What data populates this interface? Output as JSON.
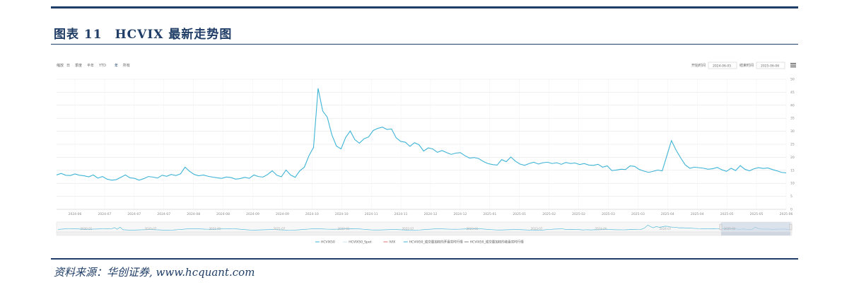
{
  "header": {
    "figure_title": "图表 11　HCVIX 最新走势图"
  },
  "source_note": "资料来源：华创证券, www.hcquant.com",
  "toolbar": {
    "zoom_label": "缩放",
    "zoom_options": [
      "日",
      "季度",
      "半年",
      "YTD",
      "年",
      "所有"
    ],
    "start_label": "开始时间",
    "start_value": "2024-06-05",
    "end_label": "结束时间",
    "end_value": "2025-06-06"
  },
  "colors": {
    "line": "#3fb4d6",
    "grid": "#e6e6e6",
    "navigator_mask": "#c9d4e3",
    "navy": "#1f3d66"
  },
  "chart_data": {
    "type": "line",
    "title": "",
    "xlabel": "",
    "ylabel": "",
    "ylim": [
      0,
      50
    ],
    "yticks": [
      0,
      5,
      10,
      15,
      20,
      25,
      30,
      35,
      40,
      45,
      50
    ],
    "x_tick_labels": [
      "2024-06",
      "2024-07",
      "2024-07",
      "2024-07",
      "2024-08",
      "2024-08",
      "2024-09",
      "2024-09",
      "2024-10",
      "2024-10",
      "2024-11",
      "2024-11",
      "2024-12",
      "2024-12",
      "2025-01",
      "2025-01",
      "2025-02",
      "2025-02",
      "2025-03",
      "2025-03",
      "2025-04",
      "2025-04",
      "2025-05",
      "2025-05",
      "2025-06"
    ],
    "navigator_tick_labels": [
      "2020-01",
      "2020-07",
      "2021-01",
      "2021-07",
      "2022-01",
      "2022-07",
      "2023-01",
      "2023-07",
      "2024-01",
      "2024-07",
      "2025-01"
    ],
    "legend": [
      "HCVIX50",
      "HCVIX50_Spot",
      "IVIX",
      "HCVIX50_成交量加权的开盘实时行情",
      "HCVIX50_成交量加权的收盘实时行情"
    ],
    "series": [
      {
        "name": "HCVIX50",
        "values": [
          13.2,
          13.8,
          13.1,
          13.0,
          13.6,
          13.1,
          12.9,
          12.5,
          13.2,
          12.0,
          12.6,
          11.6,
          11.2,
          11.4,
          12.3,
          13.2,
          12.1,
          11.9,
          11.2,
          11.8,
          12.6,
          12.4,
          12.0,
          13.1,
          12.7,
          13.4,
          13.0,
          13.6,
          16.2,
          14.6,
          13.4,
          12.9,
          13.2,
          12.7,
          12.4,
          12.1,
          11.9,
          12.4,
          12.2,
          11.6,
          11.8,
          12.3,
          11.9,
          13.2,
          12.6,
          12.4,
          13.4,
          14.8,
          13.1,
          12.5,
          15.1,
          13.2,
          12.3,
          14.8,
          16.2,
          20.6,
          23.8,
          46.5,
          37.8,
          35.4,
          28.6,
          24.3,
          23.2,
          27.6,
          30.1,
          26.8,
          25.4,
          27.1,
          27.8,
          30.3,
          31.1,
          31.6,
          30.7,
          30.9,
          27.5,
          26.1,
          25.8,
          24.2,
          25.6,
          24.8,
          22.4,
          23.6,
          23.2,
          21.9,
          22.6,
          21.8,
          21.1,
          21.6,
          21.8,
          20.6,
          19.7,
          19.9,
          19.5,
          18.4,
          17.6,
          17.2,
          17.0,
          19.1,
          18.3,
          20.1,
          18.5,
          17.4,
          16.9,
          17.6,
          18.1,
          17.4,
          17.9,
          18.1,
          17.6,
          17.9,
          17.3,
          18.0,
          17.6,
          17.8,
          17.2,
          17.6,
          17.0,
          16.9,
          17.3,
          16.2,
          16.7,
          14.9,
          15.1,
          15.4,
          15.3,
          16.7,
          16.5,
          15.3,
          14.7,
          14.2,
          14.6,
          15.1,
          14.8,
          20.6,
          26.4,
          22.8,
          19.8,
          17.1,
          15.8,
          16.2,
          16.0,
          15.8,
          15.4,
          15.6,
          16.1,
          15.2,
          14.6,
          15.8,
          14.9,
          16.8,
          15.4,
          14.8,
          15.6,
          16.0,
          15.7,
          15.9,
          15.3,
          14.8,
          14.2,
          14.0
        ]
      }
    ]
  }
}
